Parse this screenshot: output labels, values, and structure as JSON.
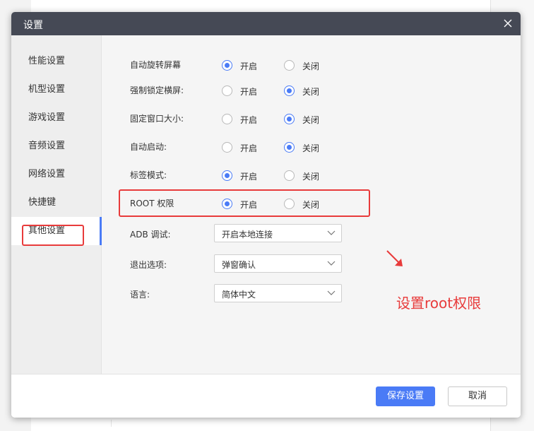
{
  "dialog": {
    "title": "设置"
  },
  "sidebar": {
    "items": [
      {
        "label": "性能设置"
      },
      {
        "label": "机型设置"
      },
      {
        "label": "游戏设置"
      },
      {
        "label": "音频设置"
      },
      {
        "label": "网络设置"
      },
      {
        "label": "快捷键"
      },
      {
        "label": "其他设置",
        "active": true
      }
    ]
  },
  "settings": {
    "on_label": "开启",
    "off_label": "关闭",
    "rows": [
      {
        "label": "自动旋转屏幕",
        "value": "开启"
      },
      {
        "label": "强制锁定横屏:",
        "value": "关闭"
      },
      {
        "label": "固定窗口大小:",
        "value": "关闭"
      },
      {
        "label": "自动启动:",
        "value": "关闭"
      },
      {
        "label": "标签模式:",
        "value": "开启"
      },
      {
        "label": "ROOT 权限",
        "value": "开启"
      }
    ],
    "selects": [
      {
        "label": "ADB 调试:",
        "value": "开启本地连接"
      },
      {
        "label": "退出选项:",
        "value": "弹窗确认"
      },
      {
        "label": "语言:",
        "value": "简体中文"
      }
    ]
  },
  "annotation": {
    "text": "设置root权限",
    "color": "#e83b3b"
  },
  "footer": {
    "save_label": "保存设置",
    "cancel_label": "取消"
  },
  "colors": {
    "accent": "#4a7bf6",
    "titlebar": "#454955"
  }
}
